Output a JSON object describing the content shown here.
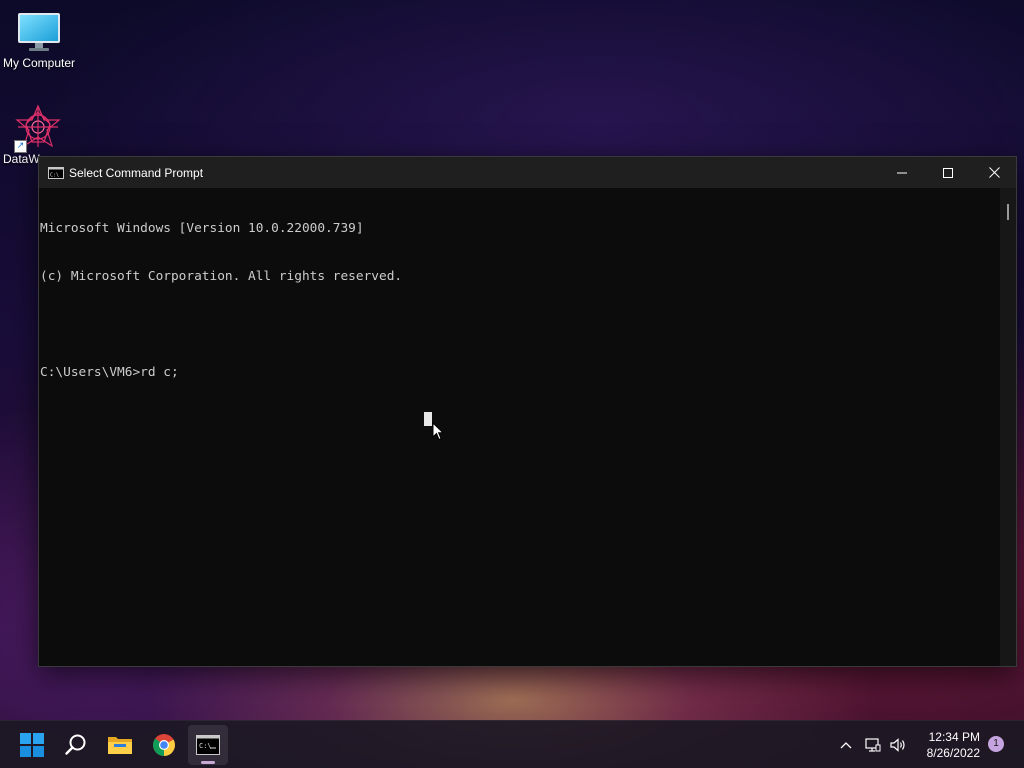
{
  "desktop": {
    "icons": [
      {
        "label": "My Computer",
        "icon": "monitor-icon"
      },
      {
        "label": "DataW",
        "icon": "datawarehouse-icon"
      }
    ]
  },
  "window": {
    "title": "Select Command Prompt",
    "icon": "cmd-icon",
    "controls": [
      "minimize-icon",
      "maximize-icon",
      "close-icon"
    ]
  },
  "console": {
    "lines": [
      "Microsoft Windows [Version 10.0.22000.739]",
      "(c) Microsoft Corporation. All rights reserved.",
      "",
      "C:\\Users\\VM6>rd c;"
    ]
  },
  "taskbar": {
    "apps": [
      "start-icon",
      "search-icon",
      "file-explorer-icon",
      "chrome-icon",
      "cmd-icon"
    ],
    "clock": {
      "time": "12:34 PM",
      "date": "8/26/2022"
    },
    "notification_count": "1"
  },
  "colors": {
    "console_bg": "#0c0c0c",
    "console_text": "#cccccc",
    "titlebar_bg": "#1f1f1f",
    "windows_blue": "#1e90e8"
  }
}
